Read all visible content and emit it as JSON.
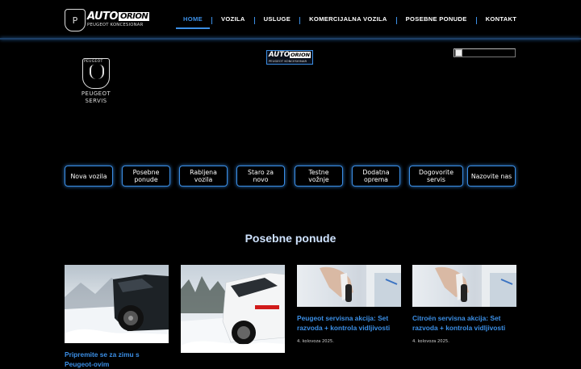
{
  "header": {
    "logo": {
      "brand": "AUTO",
      "brand_mark": "ORION",
      "subtitle": "PEUGEOT KONCESIONAR",
      "badge": "P"
    },
    "nav": [
      {
        "label": "HOME",
        "active": true
      },
      {
        "label": "VOZILA",
        "active": false
      },
      {
        "label": "USLUGE",
        "active": false
      },
      {
        "label": "KOMERCIJALNA VOZILA",
        "active": false
      },
      {
        "label": "POSEBNE PONUDE",
        "active": false
      },
      {
        "label": "KONTAKT",
        "active": false
      }
    ]
  },
  "hero": {
    "peugeot_logo": {
      "brand": "PEUGEOT",
      "line1": "PEUGEOT",
      "line2": "SERVIS"
    },
    "center_logo": {
      "brand": "AUTO",
      "brand_mark": "ORION",
      "subtitle": "PEUGEOT KONCESIONAR"
    }
  },
  "quick_links": [
    "Nova vozila",
    "Posebne ponude",
    "Rabljena vozila",
    "Staro za novo",
    "Testne vožnje",
    "Dodatna oprema",
    "Dogovorite servis",
    "Nazovite nas"
  ],
  "offers": {
    "title": "Posebne ponude",
    "cards": [
      {
        "title": "Pripremite se za zimu s Peugeot-ovim",
        "date": ""
      },
      {
        "title": "",
        "date": ""
      },
      {
        "title": "Peugeot servisna akcija: Set razvoda + kontrola vidljivosti",
        "date": "4. kolovoza 2025."
      },
      {
        "title": "Citroën servisna akcija: Set razvoda + kontrola vidljivosti",
        "date": "4. kolovoza 2025."
      }
    ]
  },
  "colors": {
    "accent": "#3b8fe6",
    "background": "#000000",
    "title": "#cfe3ff"
  }
}
